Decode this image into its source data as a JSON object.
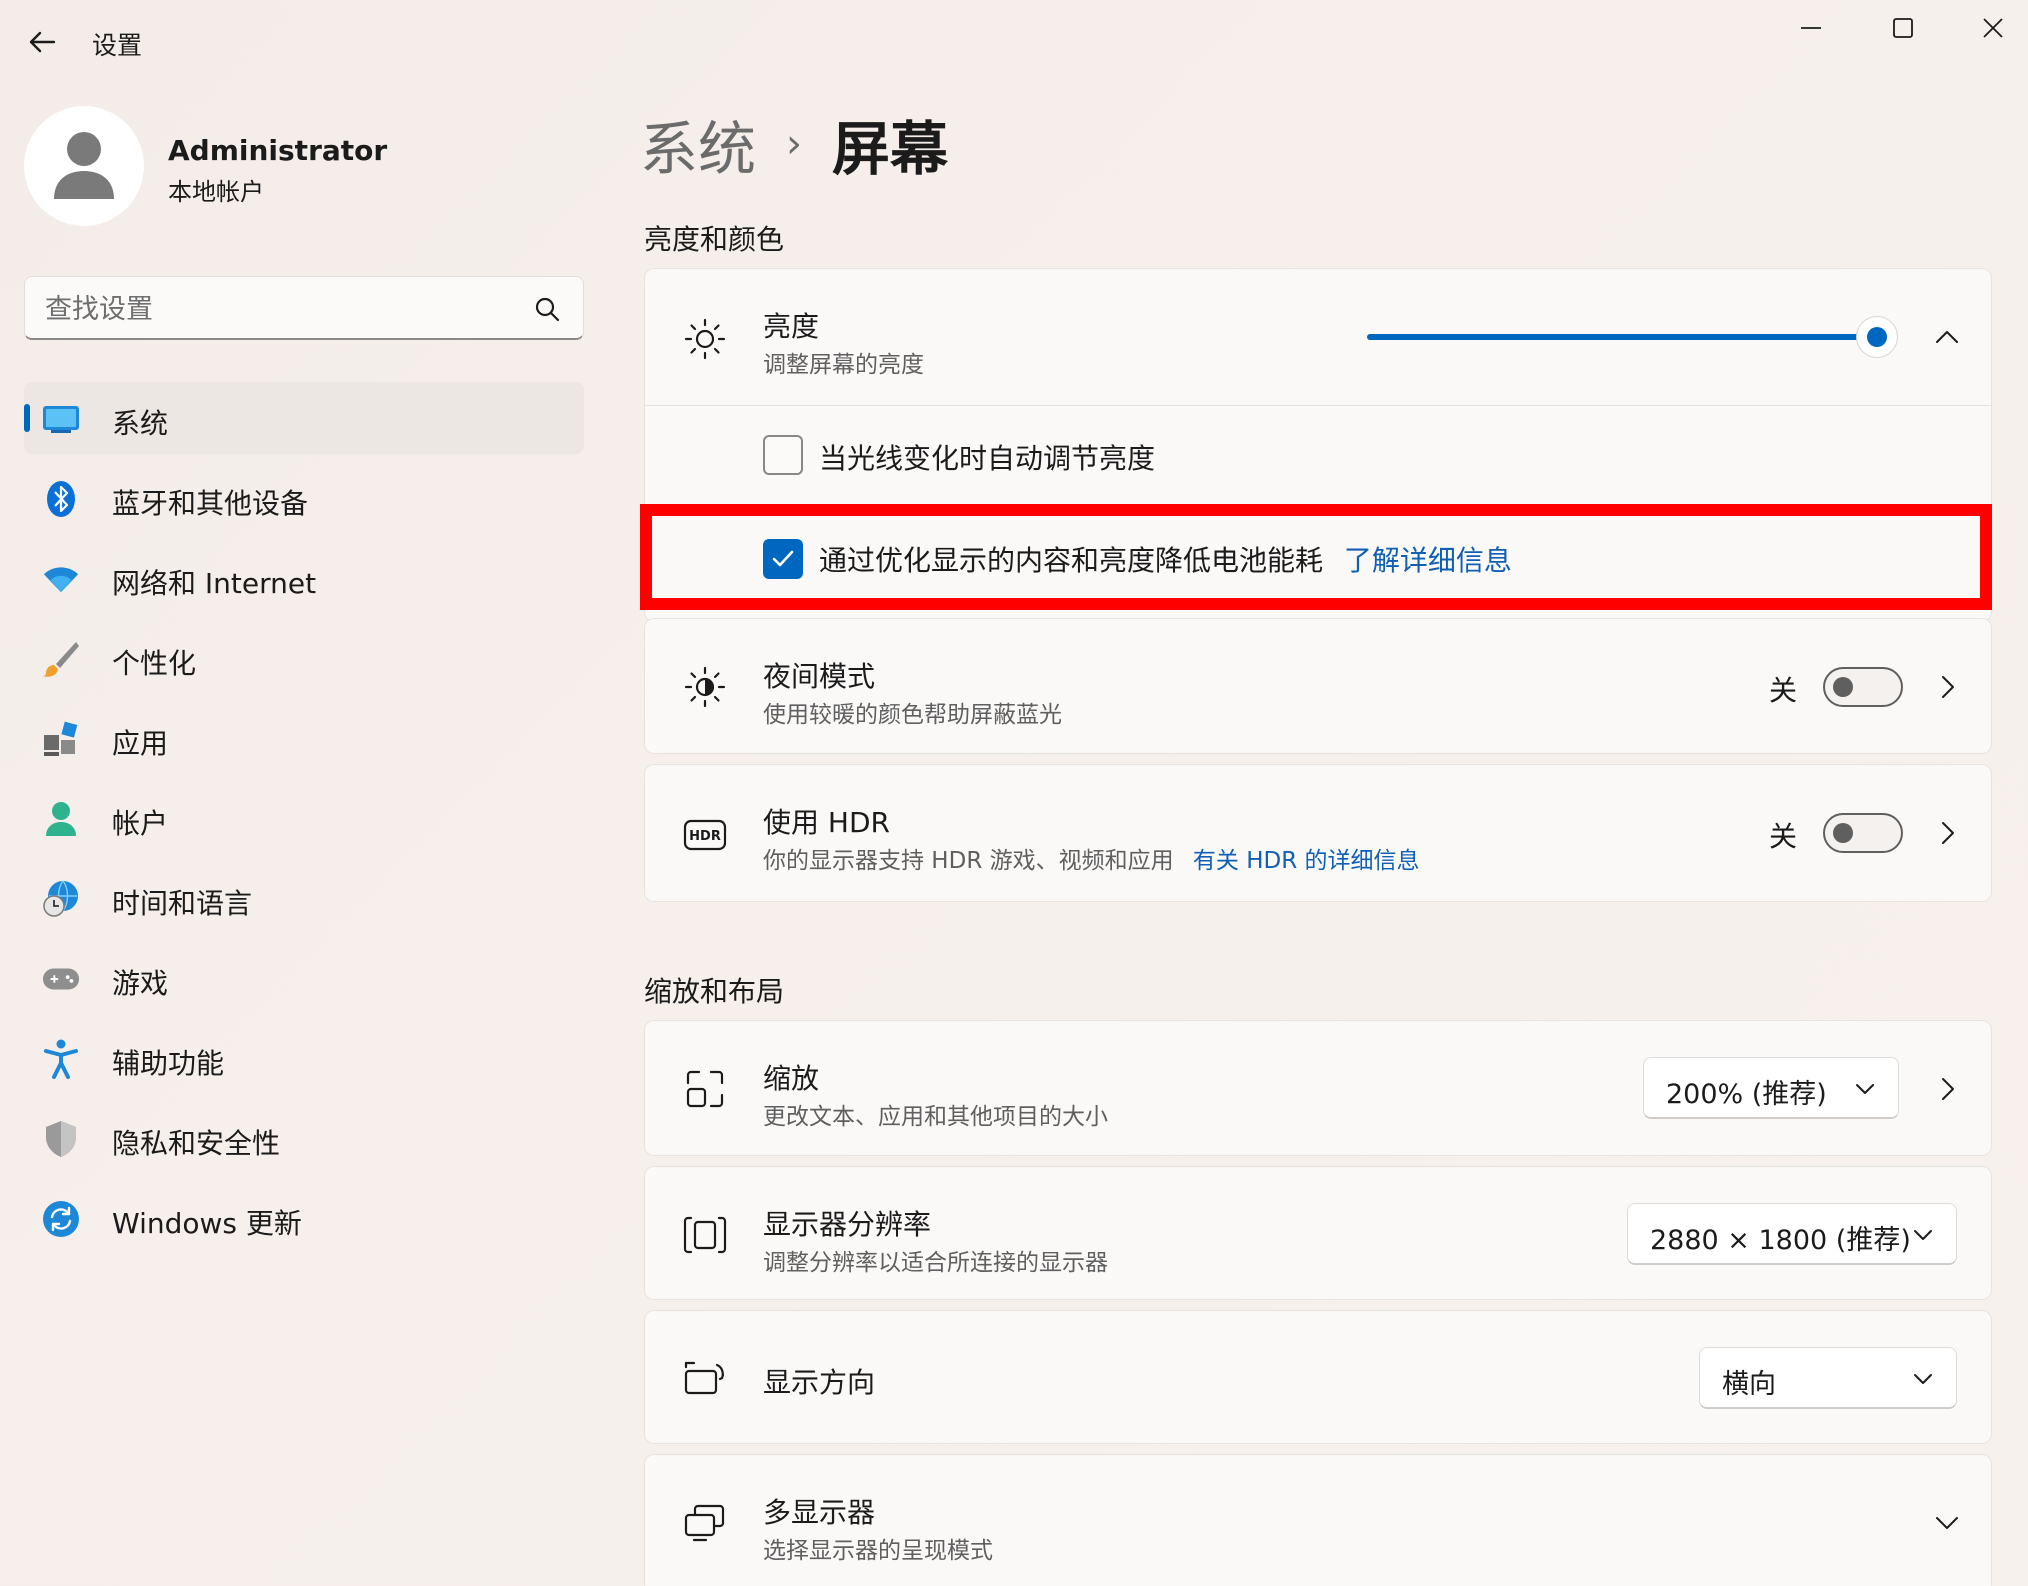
{
  "window": {
    "title": "设置"
  },
  "profile": {
    "name": "Administrator",
    "account_type": "本地帐户"
  },
  "search": {
    "placeholder": "查找设置"
  },
  "sidebar": {
    "items": [
      {
        "label": "系统",
        "icon": "monitor-icon",
        "active": true
      },
      {
        "label": "蓝牙和其他设备",
        "icon": "bluetooth-icon"
      },
      {
        "label": "网络和 Internet",
        "icon": "wifi-icon"
      },
      {
        "label": "个性化",
        "icon": "brush-icon"
      },
      {
        "label": "应用",
        "icon": "apps-icon"
      },
      {
        "label": "帐户",
        "icon": "account-icon"
      },
      {
        "label": "时间和语言",
        "icon": "globe-clock-icon"
      },
      {
        "label": "游戏",
        "icon": "gamepad-icon"
      },
      {
        "label": "辅助功能",
        "icon": "accessibility-icon"
      },
      {
        "label": "隐私和安全性",
        "icon": "shield-icon"
      },
      {
        "label": "Windows 更新",
        "icon": "update-icon"
      }
    ]
  },
  "breadcrumb": {
    "parent": "系统",
    "separator": "›",
    "current": "屏幕"
  },
  "brightness_section": {
    "title": "亮度和颜色",
    "brightness": {
      "title": "亮度",
      "subtitle": "调整屏幕的亮度",
      "value_fraction": 0.98
    },
    "auto_brightness": {
      "label": "当光线变化时自动调节亮度",
      "checked": false
    },
    "content_adaptive": {
      "label": "通过优化显示的内容和亮度降低电池能耗",
      "link": "了解详细信息",
      "checked": true
    },
    "night_light": {
      "title": "夜间模式",
      "subtitle": "使用较暖的颜色帮助屏蔽蓝光",
      "state": "关"
    },
    "hdr": {
      "title": "使用 HDR",
      "subtitle": "你的显示器支持 HDR 游戏、视频和应用",
      "link": "有关 HDR 的详细信息",
      "state": "关"
    }
  },
  "scale_section": {
    "title": "缩放和布局",
    "scale": {
      "title": "缩放",
      "subtitle": "更改文本、应用和其他项目的大小",
      "value": "200% (推荐)"
    },
    "resolution": {
      "title": "显示器分辨率",
      "subtitle": "调整分辨率以适合所连接的显示器",
      "value": "2880 × 1800 (推荐)"
    },
    "orientation": {
      "title": "显示方向",
      "value": "横向"
    },
    "multi_display": {
      "title": "多显示器",
      "subtitle": "选择显示器的呈现模式"
    }
  },
  "colors": {
    "accent": "#0067c0",
    "highlight": "#ff0000"
  }
}
